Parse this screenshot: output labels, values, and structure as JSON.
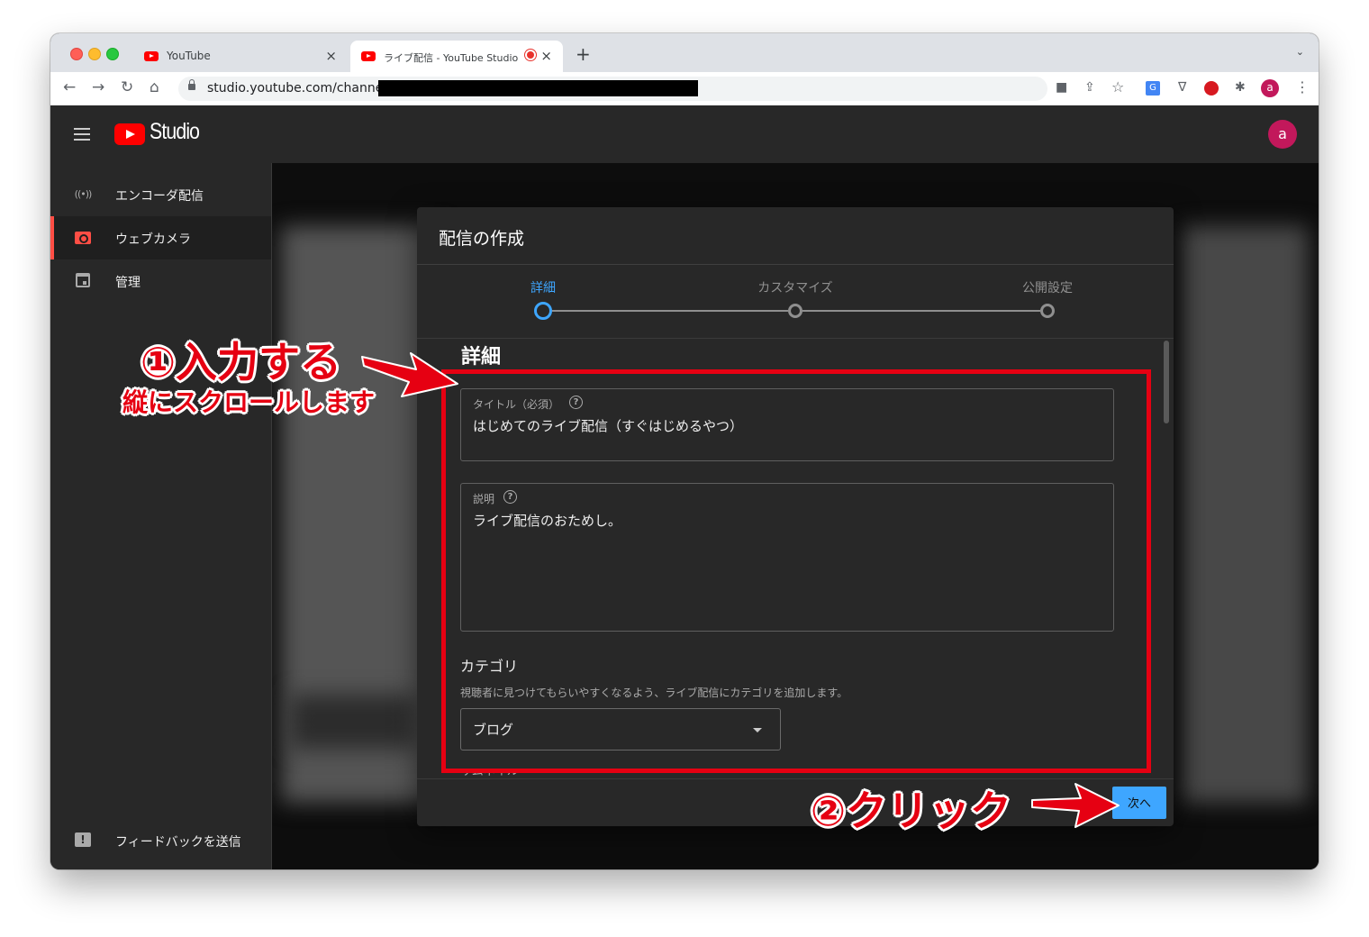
{
  "browser": {
    "tabs": [
      {
        "title": "YouTube"
      },
      {
        "title": "ライブ配信 - YouTube Studio"
      }
    ],
    "close_glyph": "×",
    "new_tab_glyph": "+",
    "menu_glyph": "⌄",
    "url": "studio.youtube.com/channel/",
    "nav": {
      "back": "←",
      "forward": "→",
      "reload": "↻",
      "home": "⌂"
    },
    "toolbar_icons": {
      "camera": "■",
      "share": "⇪",
      "star": "☆",
      "vpn": "∇",
      "extensions": "✱",
      "more": "⋮",
      "translate": "G"
    },
    "profile_initial": "a"
  },
  "studio": {
    "logo_text": "Studio",
    "avatar_initial": "a",
    "sidebar": {
      "items": [
        {
          "label": "エンコーダ配信",
          "icon": "((•))"
        },
        {
          "label": "ウェブカメラ"
        },
        {
          "label": "管理"
        }
      ],
      "feedback": {
        "label": "フィードバックを送信",
        "icon": "!"
      }
    }
  },
  "dialog": {
    "title": "配信の作成",
    "steps": [
      {
        "label": "詳細",
        "active": true
      },
      {
        "label": "カスタマイズ",
        "active": false
      },
      {
        "label": "公開設定",
        "active": false
      }
    ],
    "section_heading": "詳細",
    "help_glyph": "?",
    "title_field": {
      "label": "タイトル（必須）",
      "value": "はじめてのライブ配信（すぐはじめるやつ）"
    },
    "description_field": {
      "label": "説明",
      "value": "ライブ配信のおためし。"
    },
    "category": {
      "title": "カテゴリ",
      "help": "視聴者に見つけてもらいやすくなるよう、ライブ配信にカテゴリを追加します。",
      "selected": "ブログ"
    },
    "cutoff_text": "サムネイル",
    "next_button": "次へ"
  },
  "annotations": {
    "step1": "①入力する",
    "step1_sub": "縦にスクロールします",
    "step2": "②クリック",
    "color": "#e60012"
  },
  "colors": {
    "accent": "#3ea6ff",
    "brand_red": "#ff0000",
    "active_nav": "#ff4e45",
    "dialog_bg": "#282828"
  }
}
